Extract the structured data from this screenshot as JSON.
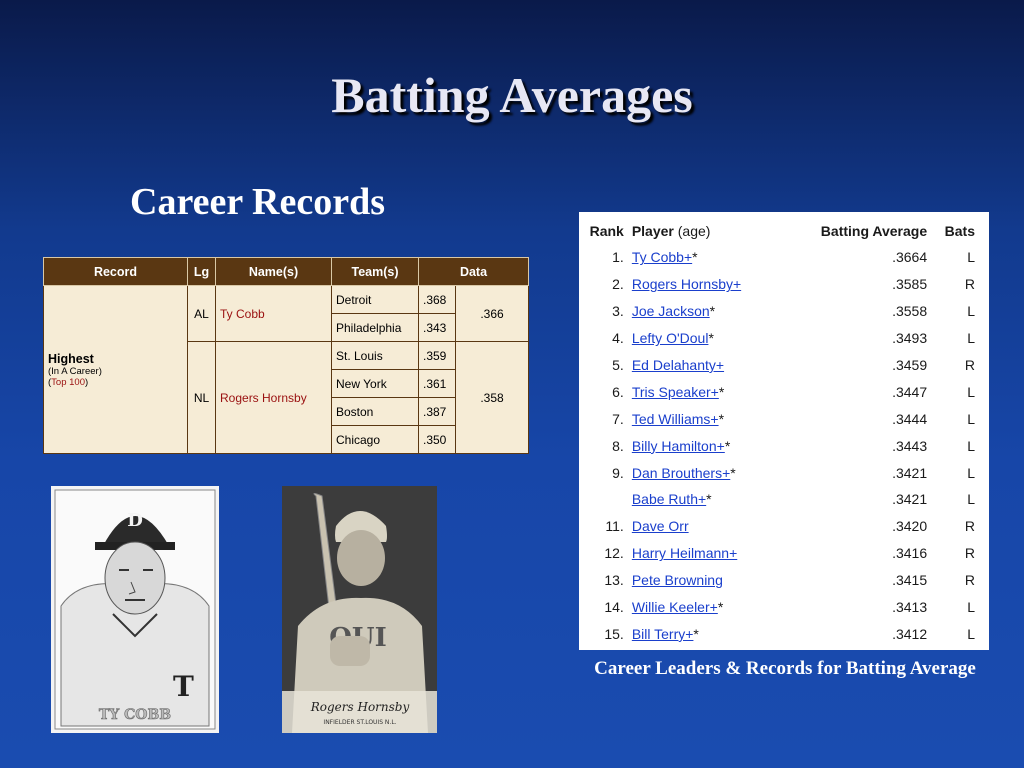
{
  "slide": {
    "title": "Batting Averages",
    "subtitle": "Career Records",
    "caption": "Career Leaders & Records for Batting Average"
  },
  "records_table": {
    "headers": [
      "Record",
      "Lg",
      "Name(s)",
      "Team(s)",
      "Data"
    ],
    "record_label": "Highest",
    "record_sub1": "(In A Career)",
    "record_sub2_prefix": "(",
    "record_sub2_link": "Top 100",
    "record_sub2_suffix": ")",
    "rows": [
      {
        "lg": "AL",
        "name": "Ty Cobb",
        "teams": [
          {
            "team": "Detroit",
            "avg": ".368"
          },
          {
            "team": "Philadelphia",
            "avg": ".343"
          }
        ],
        "total": ".366"
      },
      {
        "lg": "NL",
        "name": "Rogers Hornsby",
        "teams": [
          {
            "team": "St. Louis",
            "avg": ".359"
          },
          {
            "team": "New York",
            "avg": ".361"
          },
          {
            "team": "Boston",
            "avg": ".387"
          },
          {
            "team": "Chicago",
            "avg": ".350"
          }
        ],
        "total": ".358"
      }
    ]
  },
  "photos": {
    "cobb_caption": "TY COBB",
    "cobb_cap_letter": "D",
    "hornsby_signature": "Rogers Hornsby",
    "hornsby_line": "INFIELDER ST.LOUIS N.L."
  },
  "leaders_table": {
    "headers": {
      "rank": "Rank",
      "player": "Player",
      "age": "(age)",
      "avg": "Batting Average",
      "bats": "Bats"
    },
    "rows": [
      {
        "rank": "1.",
        "player": "Ty Cobb+",
        "mark": "*",
        "avg": ".3664",
        "bats": "L"
      },
      {
        "rank": "2.",
        "player": "Rogers Hornsby+",
        "mark": "",
        "avg": ".3585",
        "bats": "R"
      },
      {
        "rank": "3.",
        "player": "Joe Jackson",
        "mark": "*",
        "avg": ".3558",
        "bats": "L"
      },
      {
        "rank": "4.",
        "player": "Lefty O'Doul",
        "mark": "*",
        "avg": ".3493",
        "bats": "L"
      },
      {
        "rank": "5.",
        "player": "Ed Delahanty+",
        "mark": "",
        "avg": ".3459",
        "bats": "R"
      },
      {
        "rank": "6.",
        "player": "Tris Speaker+",
        "mark": "*",
        "avg": ".3447",
        "bats": "L"
      },
      {
        "rank": "7.",
        "player": "Ted Williams+",
        "mark": "*",
        "avg": ".3444",
        "bats": "L"
      },
      {
        "rank": "8.",
        "player": "Billy Hamilton+",
        "mark": "*",
        "avg": ".3443",
        "bats": "L"
      },
      {
        "rank": "9.",
        "player": "Dan Brouthers+",
        "mark": "*",
        "avg": ".3421",
        "bats": "L"
      },
      {
        "rank": "",
        "player": "Babe Ruth+",
        "mark": "*",
        "avg": ".3421",
        "bats": "L"
      },
      {
        "rank": "11.",
        "player": "Dave Orr",
        "mark": "",
        "avg": ".3420",
        "bats": "R"
      },
      {
        "rank": "12.",
        "player": "Harry Heilmann+",
        "mark": "",
        "avg": ".3416",
        "bats": "R"
      },
      {
        "rank": "13.",
        "player": "Pete Browning",
        "mark": "",
        "avg": ".3415",
        "bats": "R"
      },
      {
        "rank": "14.",
        "player": "Willie Keeler+",
        "mark": "*",
        "avg": ".3413",
        "bats": "L"
      },
      {
        "rank": "15.",
        "player": "Bill Terry+",
        "mark": "*",
        "avg": ".3412",
        "bats": "L"
      }
    ]
  }
}
